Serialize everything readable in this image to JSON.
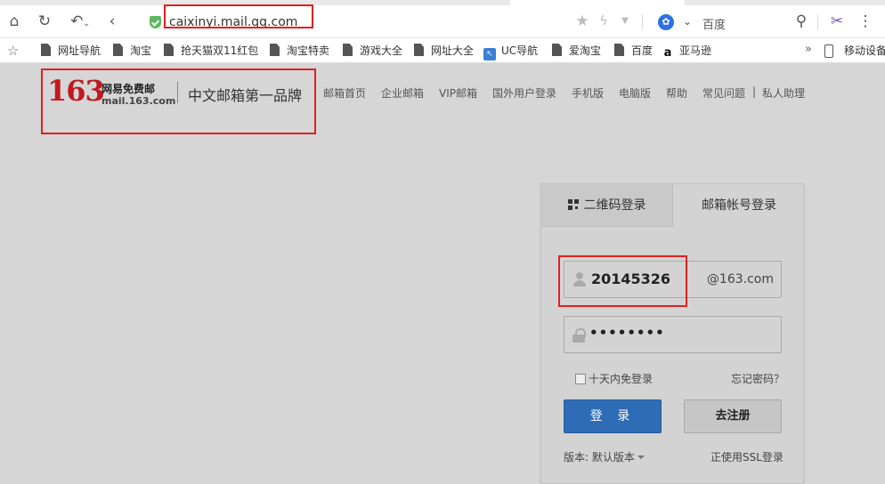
{
  "browser": {
    "url": "caixinyi.mail.qq.com",
    "search_engine_label": "百度",
    "bookmarks": [
      "网址导航",
      "淘宝",
      "抢天猫双11红包",
      "淘宝特卖",
      "游戏大全",
      "网址大全",
      "UC导航",
      "爱淘宝",
      "百度",
      "亚马逊"
    ],
    "bookmark_more": "»",
    "mobile_label": "移动设备"
  },
  "header": {
    "logo_number": "163",
    "logo_cn": "网易免费邮",
    "logo_url": "mail.163.com",
    "slogan": "中文邮箱第一品牌",
    "nav": [
      "邮箱首页",
      "企业邮箱",
      "VIP邮箱",
      "国外用户登录",
      "手机版",
      "电脑版",
      "帮助",
      "常见问题",
      "|",
      "私人助理"
    ]
  },
  "login": {
    "tab_qr": "二维码登录",
    "tab_account": "邮箱帐号登录",
    "username": "20145326",
    "domain_suffix": "@163.com",
    "password_mask": "••••••••",
    "remember_label": "十天内免登录",
    "forgot_label": "忘记密码？",
    "login_button": "登 录",
    "register_button": "去注册",
    "version_label": "版本: 默认版本",
    "ssl_label": "正使用SSL登录"
  },
  "colors": {
    "brand_red": "#c11920",
    "login_blue": "#2f6cb6",
    "highlight_red": "#e02020"
  }
}
